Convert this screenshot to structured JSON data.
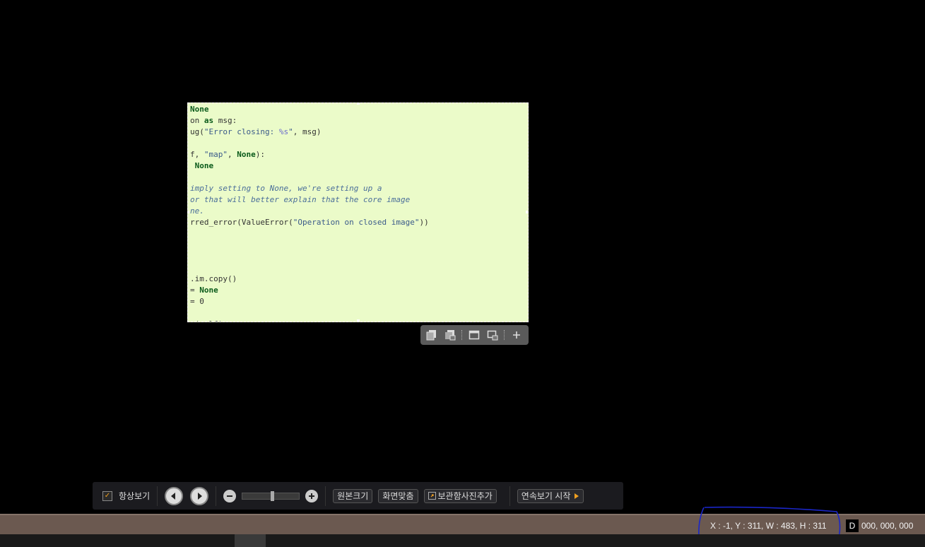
{
  "code_lines": [
    [
      {
        "t": "None",
        "c": "kw"
      }
    ],
    [
      {
        "t": "on ",
        "c": ""
      },
      {
        "t": "as",
        "c": "kw"
      },
      {
        "t": " msg:",
        "c": ""
      }
    ],
    [
      {
        "t": "ug(",
        "c": ""
      },
      {
        "t": "\"Error closing: ",
        "c": "str"
      },
      {
        "t": "%s",
        "c": "fmt"
      },
      {
        "t": "\"",
        "c": "str"
      },
      {
        "t": ", msg)",
        "c": ""
      }
    ],
    [],
    [
      {
        "t": "f, ",
        "c": ""
      },
      {
        "t": "\"map\"",
        "c": "str"
      },
      {
        "t": ", ",
        "c": ""
      },
      {
        "t": "None",
        "c": "kw"
      },
      {
        "t": "):",
        "c": ""
      }
    ],
    [
      {
        "t": " ",
        "c": ""
      },
      {
        "t": "None",
        "c": "kw"
      }
    ],
    [],
    [
      {
        "t": "imply setting to None, we're setting up a",
        "c": "cmt"
      }
    ],
    [
      {
        "t": "or that will better explain that the core image",
        "c": "cmt"
      }
    ],
    [
      {
        "t": "ne.",
        "c": "cmt"
      }
    ],
    [
      {
        "t": "rred_error(ValueError(",
        "c": ""
      },
      {
        "t": "\"Operation on closed image\"",
        "c": "str"
      },
      {
        "t": "))",
        "c": ""
      }
    ],
    [],
    [],
    [],
    [],
    [
      {
        "t": ".im.copy()",
        "c": ""
      }
    ],
    [
      {
        "t": "= ",
        "c": ""
      },
      {
        "t": "None",
        "c": "kw"
      }
    ],
    [
      {
        "t": "= 0",
        "c": ""
      }
    ],
    [],
    [
      {
        "t": "n(self)",
        "c": ""
      }
    ]
  ],
  "capture_toolbar": {
    "icons": [
      "copy-icon",
      "copy-to-storage-icon",
      "capture-window-icon",
      "capture-storage-icon",
      "expand-icon"
    ]
  },
  "viewer": {
    "always_on_top_label": "항상보기",
    "always_on_top_checked": true,
    "zoom_level_fraction": 0.5,
    "original_size_label": "원본크기",
    "fit_screen_label": "화면맞춤",
    "add_to_storage_label": "보관함사진추가",
    "slideshow_label": "연속보기 시작"
  },
  "status": {
    "coords": "X : -1, Y : 311, W : 483, H : 311",
    "d_badge": "D",
    "color_value": "000, 000, 000"
  },
  "colors": {
    "capture_bg": "#ebfbc9",
    "status_bg": "#6b5950",
    "toolbar_bg": "#1b1b1f",
    "accent": "#f0a020"
  }
}
